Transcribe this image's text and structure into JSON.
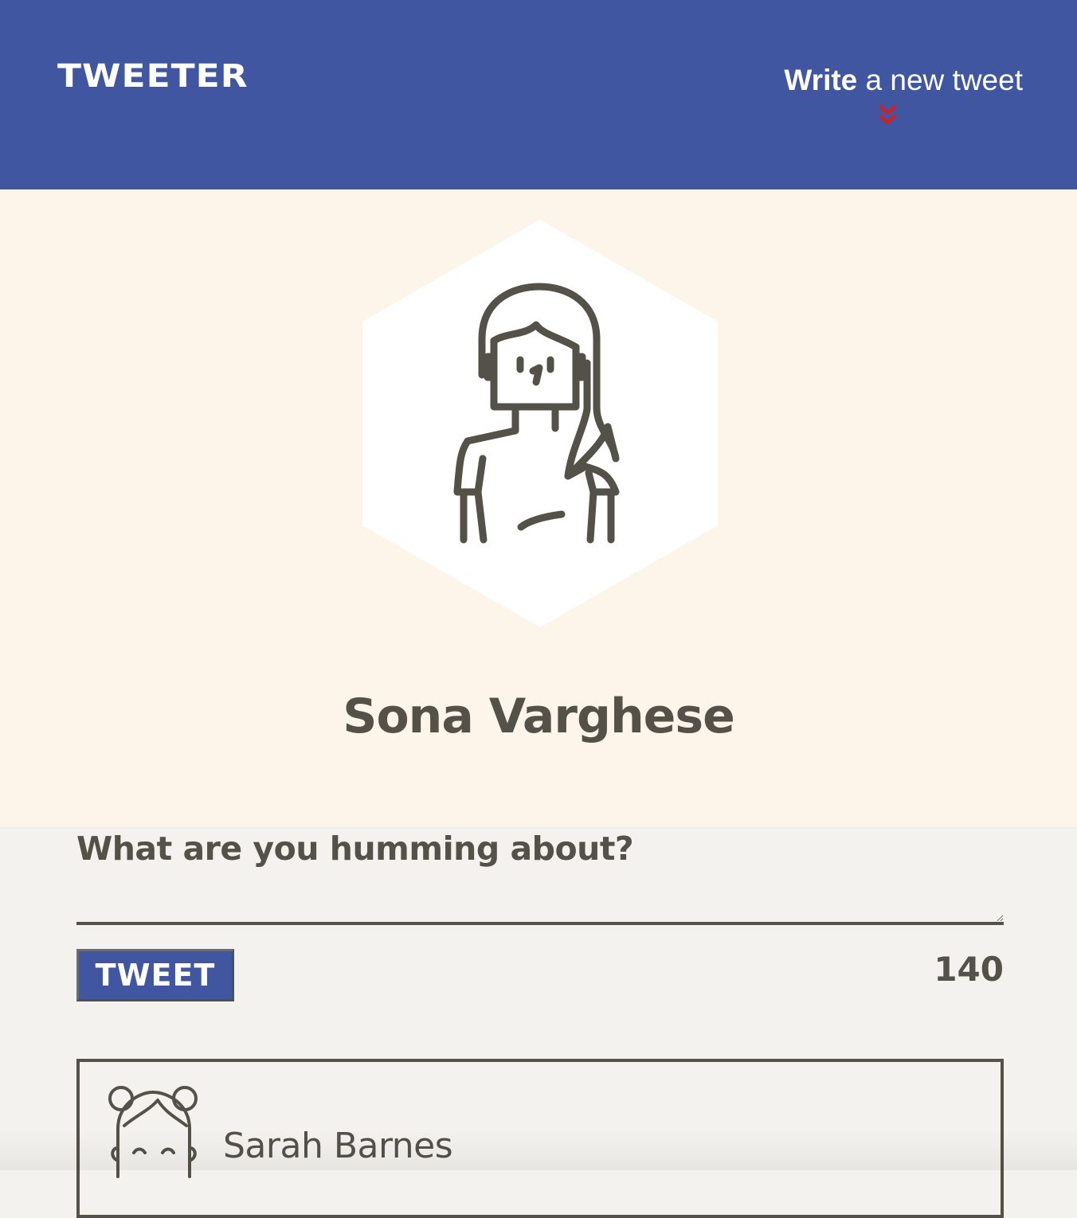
{
  "nav": {
    "brand": "TWEETER",
    "compose_toggle": {
      "bold_part": "Write",
      "rest": " a new tweet",
      "icon": "double-chevron-down-icon"
    }
  },
  "profile": {
    "name": "Sona Varghese",
    "avatar_icon": "woman-avatar-icon"
  },
  "compose": {
    "label": "What are you humming about?",
    "textarea_value": "",
    "submit_label": "TWEET",
    "char_count": "140"
  },
  "tweets": [
    {
      "author": "Sarah Barnes",
      "avatar_icon": "woman-avatar-icon"
    }
  ],
  "colors": {
    "nav_bg": "#4056a1",
    "profile_bg": "#fdf5e9",
    "page_bg": "#f3f2ee",
    "text": "#545149",
    "accent_red": "#d91c1c"
  }
}
